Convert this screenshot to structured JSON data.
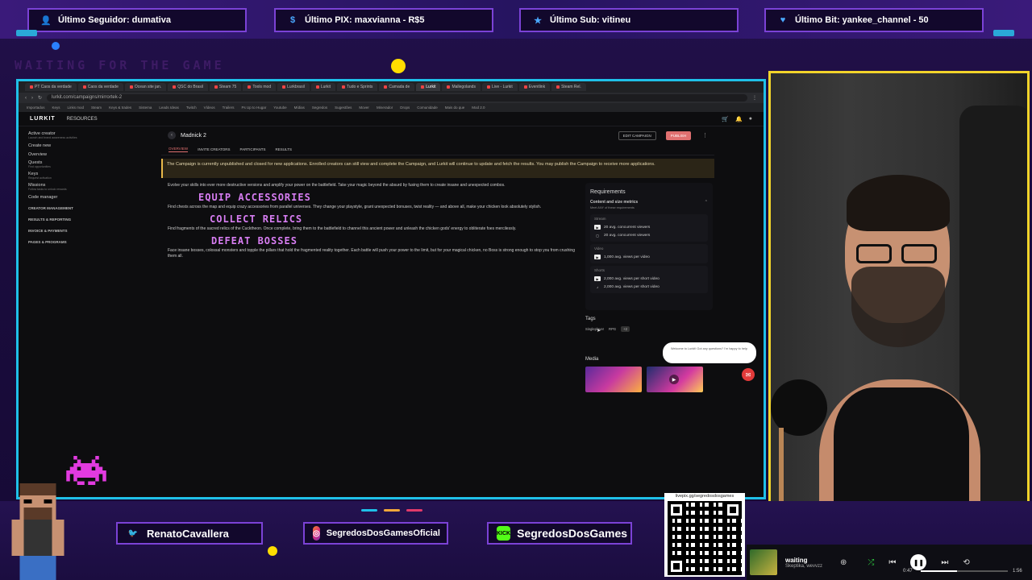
{
  "alerts": [
    {
      "icon": "person-icon",
      "text": "Último Seguidor: dumativa"
    },
    {
      "icon": "dollar-icon",
      "text": "Último PIX: maxvianna - R$5"
    },
    {
      "icon": "star-icon",
      "text": "Último Sub: vitineu"
    },
    {
      "icon": "heart-icon",
      "text": "Último Bit: yankee_channel - 50"
    }
  ],
  "overlay_ghost_text": "WAITING FOR THE GAME",
  "browser": {
    "tabs": [
      "PT Caos da verdade",
      "Caos da verdade",
      "Ocean site jan.",
      "QSC do Brasil",
      "Steam 75",
      "Tools mod",
      "Lurkbrasil",
      "Lurkit",
      "Tudo e Sprints",
      "Camada de",
      "Lurkit",
      "Mallegolands",
      "Live - Lurkit",
      "Eventlink",
      "Steam Rel."
    ],
    "url": "lurkit.com/campaigns/mirrortek-2",
    "bookmarks": [
      "Importados",
      "Keys",
      "Links mod",
      "Steam",
      "Keys & trades",
      "Sistema",
      "Leads Ideas",
      "Twitch",
      "Vídeos",
      "Trailers",
      "Ps Up to Hugar",
      "Youtube",
      "Mídias",
      "Segredos",
      "Sugestões",
      "Mover",
      "Minerador",
      "Drops",
      "Comunidade",
      "Mais do que",
      "Mod 2.0"
    ]
  },
  "lurkit": {
    "logo": "LURKIT",
    "resources": "RESOURCES",
    "sidebar": [
      {
        "label": "Active creator",
        "sub": "Launch and brand awareness activities"
      },
      {
        "label": "Create new",
        "sub": ""
      },
      {
        "label": "Overview",
        "sub": ""
      },
      {
        "label": "Quests",
        "sub": "Find opportunities"
      },
      {
        "label": "Keys",
        "sub": "Request activation"
      },
      {
        "label": "Missions",
        "sub": "Follow tasks to unlock rewards"
      },
      {
        "label": "Code manager",
        "sub": ""
      }
    ],
    "sidebar_sections": [
      "CREATOR MANAGEMENT",
      "RESULTS & REPORTING",
      "INVOICE & PAYMENTS",
      "PAGES & PROGRAMS"
    ],
    "campaign": {
      "name": "Madnick 2",
      "edit_label": "EDIT CAMPAIGN",
      "publish_label": "PUBLISH",
      "tabs": [
        "OVERVIEW",
        "INVITE CREATORS",
        "PARTICIPANTS",
        "RESULTS"
      ],
      "notice": "The Campaign is currently unpublished and closed for new applications. Enrolled creators can still view and complete the Campaign, and Lurkit will continue to update and fetch the results. You may publish the Campaign to receive more applications.",
      "intro": "Evolve your skills into ever more destructive versions and amplify your power on the battlefield. Take your magic beyond the absurd by fusing them to create insane and unexpected combos.",
      "sections": [
        {
          "heading": "EQUIP ACCESSORIES",
          "body": "Find chests across the map and equip crazy accessories from parallel universes. They change your playstyle, grant unexpected bonuses, twist reality — and above all, make your chicken look absolutely stylish."
        },
        {
          "heading": "COLLECT RELICS",
          "body": "Find fragments of the sacred relics of the Cucktheon. Once complete, bring them to the battlefield to channel this ancient power and unleash the chicken gods' energy to obliterate foes mercilessly."
        },
        {
          "heading": "DEFEAT BOSSES",
          "body": "Face insane bosses, colossal monsters and topple the pillars that hold the fragmented reality together. Each battle will push your power to the limit, but for your magical chicken, no Boss is strong enough to stop you from crushing them all."
        }
      ]
    },
    "requirements": {
      "title": "Requirements",
      "section": "Content and size metrics",
      "note": "Meet ANY of these requirements",
      "groups": [
        {
          "platform": "Stream",
          "items": [
            {
              "icon": "youtube-icon",
              "text": "20 avg. concurrent viewers"
            },
            {
              "icon": "twitch-icon",
              "text": "20 avg. concurrent viewers"
            }
          ]
        },
        {
          "platform": "Video",
          "items": [
            {
              "icon": "youtube-icon",
              "text": "1,000 avg. views per video"
            }
          ]
        },
        {
          "platform": "Shorts",
          "items": [
            {
              "icon": "youtube-icon",
              "text": "2,000 avg. views per short video"
            },
            {
              "icon": "tiktok-icon",
              "text": "2,000 avg. views per short video"
            }
          ]
        }
      ]
    },
    "tags": {
      "title": "Tags",
      "items": [
        "Singleplayer",
        "RPG"
      ],
      "more": "+2"
    },
    "media": {
      "title": "Media"
    },
    "toast": "Welcome to Lurkit! Got any questions? I'm happy to help"
  },
  "socials": [
    {
      "icon": "twitter-icon",
      "text": "RenatoCavallera"
    },
    {
      "icon": "instagram-icon",
      "text": "SegredosDosGamesOficial"
    },
    {
      "icon": "kick-icon",
      "text": "SegredosDosGames",
      "badge": "KICK"
    }
  ],
  "qr": {
    "url": "livepix.gg/segredosdosgames"
  },
  "player": {
    "song": "waiting",
    "artist": "Skeptika, wevvzz",
    "elapsed": "0:47",
    "duration": "1:56",
    "progress": 0.42
  },
  "colors": {
    "accent": "#7b42d6",
    "frame": "#1fc0e8",
    "cam_border": "#f2d42a",
    "heading": "#d77df2",
    "publish": "#e07070"
  }
}
